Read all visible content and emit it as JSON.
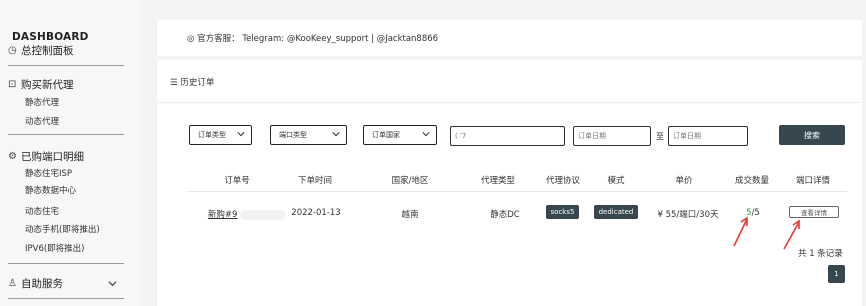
{
  "sidebar": {
    "brand_en": "DASHBOARD",
    "brand_cn": "总控制面板",
    "buy_title": "购买新代理",
    "buy_items": [
      "静态代理",
      "动态代理"
    ],
    "bought_title": "已购端口明细",
    "bought_items": [
      "静态住宅ISP",
      "静态数据中心",
      "动态住宅",
      "动态手机(即将推出)",
      "IPV6(即将推出)"
    ],
    "self_service": "自助服务"
  },
  "support": {
    "text": "官方客服： Telegram: @KooKeey_support | @Jacktan8866"
  },
  "orders": {
    "breadcrumb": "历史订单",
    "filters": {
      "order_type": "订单类型",
      "port_type": "端口类型",
      "order_country": "订单国家",
      "keyword_value": "(         '7",
      "date_from_placeholder": "订单日期",
      "date_to_placeholder": "订单日期",
      "range_sep": "至",
      "search": "搜索"
    },
    "columns": [
      "订单号",
      "下单时间",
      "国家/地区",
      "代理类型",
      "代理协议",
      "模式",
      "单价",
      "成交数量",
      "端口详情"
    ],
    "rows": [
      {
        "order_no": "新购#9",
        "time": "2022-01-13",
        "country": "越南",
        "proxy_type": "静态DC",
        "protocol": "socks5",
        "mode": "dedicated",
        "price": "¥ 55/端口/30天",
        "qty_done": "5",
        "qty_total": "/5",
        "detail": "查看详情"
      }
    ],
    "total_text": "共 1 条记录",
    "page": "1"
  },
  "colors": {
    "accent_dark": "#37474f",
    "annotation_red": "#e53935",
    "qty_green": "#2e9e3e"
  }
}
